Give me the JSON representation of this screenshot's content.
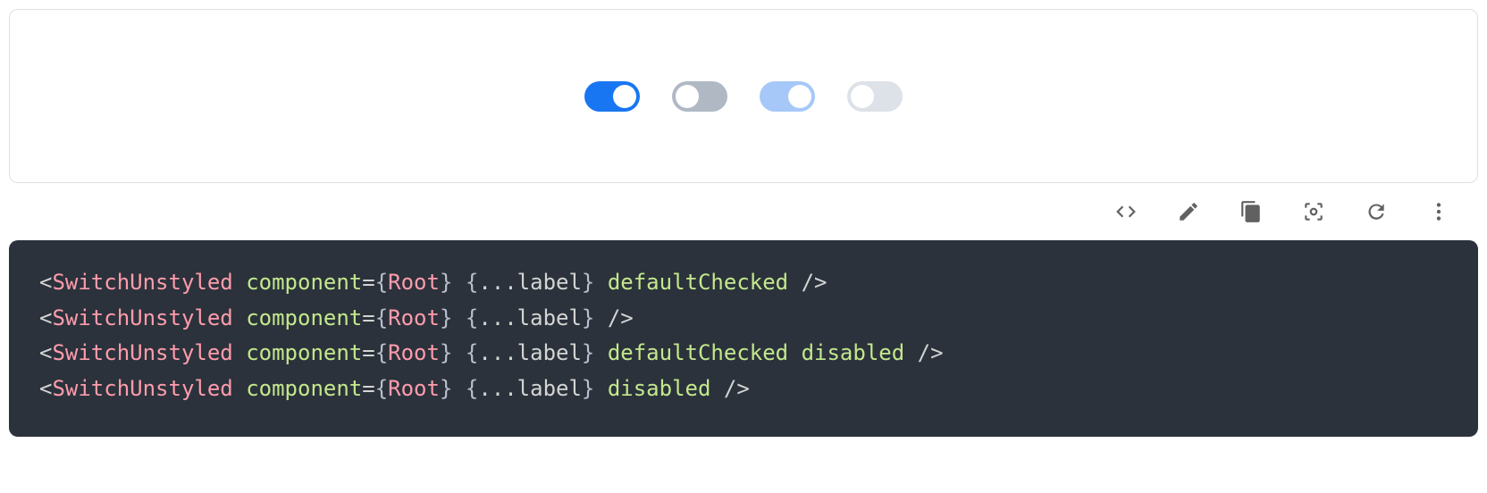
{
  "demo": {
    "switches": [
      {
        "state": "on",
        "disabled": false
      },
      {
        "state": "off",
        "disabled": false
      },
      {
        "state": "on",
        "disabled": true
      },
      {
        "state": "off",
        "disabled": true
      }
    ]
  },
  "toolbar": {
    "icons": [
      "code",
      "edit",
      "copy",
      "capture",
      "reset",
      "more"
    ]
  },
  "code": {
    "lines": [
      {
        "tag": "SwitchUnstyled",
        "attr": "component",
        "comp": "Root",
        "prop": "label",
        "extras": [
          "defaultChecked"
        ]
      },
      {
        "tag": "SwitchUnstyled",
        "attr": "component",
        "comp": "Root",
        "prop": "label",
        "extras": []
      },
      {
        "tag": "SwitchUnstyled",
        "attr": "component",
        "comp": "Root",
        "prop": "label",
        "extras": [
          "defaultChecked",
          "disabled"
        ]
      },
      {
        "tag": "SwitchUnstyled",
        "attr": "component",
        "comp": "Root",
        "prop": "label",
        "extras": [
          "disabled"
        ]
      }
    ]
  }
}
